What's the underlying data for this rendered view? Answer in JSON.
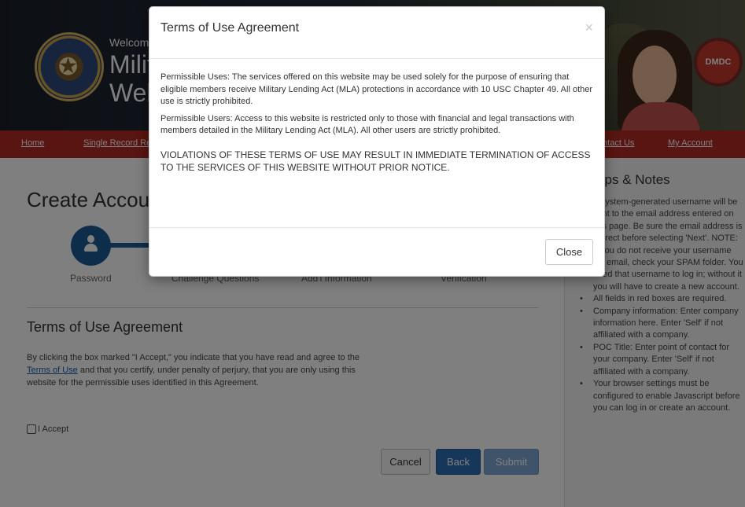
{
  "header": {
    "welcome": "Welcome to the",
    "title_line1": "Military Lending Act",
    "title_line2": "Website",
    "logo_text": "DMDC",
    "seal_icon": "dod-seal-icon"
  },
  "nav": {
    "items": [
      "Home",
      "Single Record Request",
      "Contact Us",
      "My Account"
    ]
  },
  "page": {
    "title": "Create Account",
    "steps": [
      "Password",
      "Challenge Questions",
      "Add'l Information",
      "Verification"
    ],
    "section_title": "Terms of Use Agreement",
    "section_text_pre": "By clicking the box marked \"I Accept,\" you indicate that you have read and agree to the ",
    "section_text_link": "Terms of Use",
    "section_text_post": " and that you certify, under penalty of perjury, that you are only using this website for the permissible uses identified in this Agreement.",
    "accept_label": "I Accept",
    "buttons": {
      "cancel": "Cancel",
      "back": "Back",
      "submit": "Submit"
    }
  },
  "sidebar": {
    "title": "Tips & Notes",
    "items": [
      "A system-generated username will be sent to the email address entered on this page. Be sure the email address is correct before selecting 'Next'. NOTE: If you do not receive your username via email, check your SPAM folder. You need that username to log in; without it you will have to create a new account.",
      "All fields in red boxes are required.",
      "Company information: Enter company information here. Enter 'Self' if not affiliated with a company.",
      "POC Title: Enter point of contact for your company. Enter 'Self' if not affiliated with a company.",
      "Your browser settings must be configured to enable Javascript before you can log in or create an account."
    ]
  },
  "modal": {
    "title": "Terms of Use Agreement",
    "close_x": "×",
    "p1": "Permissible Uses: The services offered on this website may be used solely for the purpose of ensuring that eligible members receive Military Lending Act (MLA) protections in accordance with 10 USC Chapter 49. All other use is strictly prohibited.",
    "p2": "Permissible Users: Access to this website is restricted only to those with financial and legal transactions with members detailed in the Military Lending Act (MLA). All other users are strictly prohibited.",
    "p3": "VIOLATIONS OF THESE TERMS OF USE MAY RESULT IN IMMEDIATE TERMINATION OF ACCESS TO THE SERVICES OF THIS WEBSITE WITHOUT PRIOR NOTICE.",
    "close_button": "Close"
  },
  "colors": {
    "nav_red": "#b22a22",
    "primary_blue": "#2d6eb5",
    "step_blue": "#1c5a96"
  }
}
